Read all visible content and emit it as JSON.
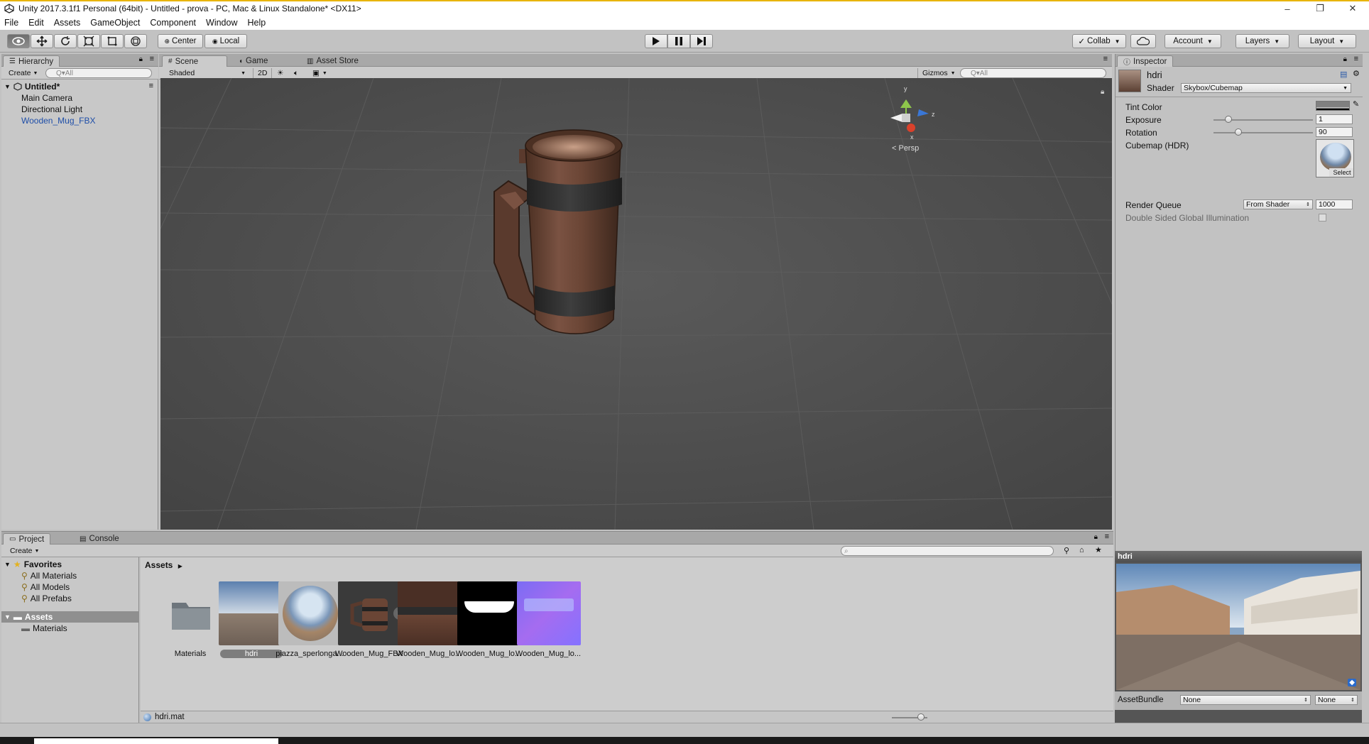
{
  "window": {
    "title": "Unity 2017.3.1f1 Personal (64bit) - Untitled - prova - PC, Mac & Linux Standalone* <DX11>",
    "controls": [
      "–",
      "❐",
      "✕"
    ]
  },
  "menu": [
    "File",
    "Edit",
    "Assets",
    "GameObject",
    "Component",
    "Window",
    "Help"
  ],
  "toolbar": {
    "pivot_center": "Center",
    "pivot_local": "Local",
    "collab": "Collab",
    "account": "Account",
    "layers": "Layers",
    "layout": "Layout"
  },
  "hierarchy": {
    "tab": "Hierarchy",
    "create": "Create",
    "search_placeholder": "Q▾All",
    "scene_name": "Untitled*",
    "items": [
      "Main Camera",
      "Directional Light",
      "Wooden_Mug_FBX"
    ]
  },
  "scene": {
    "tabs": [
      "Scene",
      "Game",
      "Asset Store"
    ],
    "shading_mode": "Shaded",
    "mode_2d": "2D",
    "gizmos": "Gizmos",
    "search_placeholder": "Q▾All",
    "persp_label": "< Persp",
    "axis_labels": {
      "y": "y",
      "z": "z",
      "x": "x"
    }
  },
  "inspector": {
    "tab": "Inspector",
    "material_name": "hdri",
    "shader_label": "Shader",
    "shader_value": "Skybox/Cubemap",
    "tint_color": "Tint Color",
    "exposure_label": "Exposure",
    "exposure_value": "1",
    "exposure_level": 0.15,
    "rotation_label": "Rotation",
    "rotation_value": "90",
    "rotation_level": 0.25,
    "cubemap_label": "Cubemap   (HDR)",
    "select": "Select",
    "render_queue_label": "Render Queue",
    "render_queue_mode": "From Shader",
    "render_queue_value": "1000",
    "double_sided": "Double Sided Global Illumination"
  },
  "project": {
    "tabs": [
      "Project",
      "Console"
    ],
    "create": "Create",
    "favorites": "Favorites",
    "favorite_items": [
      "All Materials",
      "All Models",
      "All Prefabs"
    ],
    "assets_root": "Assets",
    "asset_folders": [
      "Materials"
    ],
    "breadcrumb": "Assets",
    "assets": [
      {
        "name": "Materials",
        "kind": "folder"
      },
      {
        "name": "hdri",
        "kind": "material",
        "selected": true
      },
      {
        "name": "piazza_sperlonga...",
        "kind": "hdr"
      },
      {
        "name": "Wooden_Mug_FBX",
        "kind": "model"
      },
      {
        "name": "Wooden_Mug_lo...",
        "kind": "albedo"
      },
      {
        "name": "Wooden_Mug_lo...",
        "kind": "mask"
      },
      {
        "name": "Wooden_Mug_lo...",
        "kind": "normal"
      }
    ],
    "selected_path": "hdri.mat"
  },
  "preview": {
    "title": "hdri",
    "assetbundle_label": "AssetBundle",
    "bundle_value": "None",
    "variant_value": "None"
  },
  "colors": {
    "selection_blue": "#1e4ea8",
    "scene_bg": "#4a4a4a",
    "panel_bg": "#c2c2c2"
  }
}
